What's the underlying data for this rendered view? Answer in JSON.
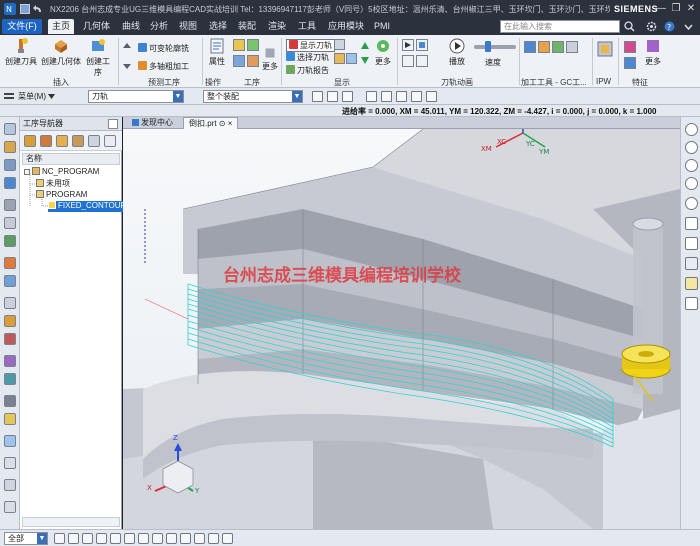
{
  "window": {
    "title": "NX2206 台州志成专业UG三维模具编程CAD实战培训  Tel：13396947117彭老师（V同号）5校区地址：温州乐清、台州椒江三甲、玉环坎门、玉环沙门、玉环坎门 - 加工",
    "brand": "SIEMENS",
    "minimize": "—",
    "restore": "❐",
    "close": "✕"
  },
  "menu": {
    "file": "文件(F)",
    "tabs": [
      "主页",
      "几何体",
      "曲线",
      "分析",
      "视图",
      "选择",
      "装配",
      "渲染",
      "工具",
      "应用模块",
      "PMI"
    ],
    "active_tab": "主页",
    "search_placeholder": "在此输入搜索"
  },
  "ribbon": {
    "create_tool": "创建刀具",
    "create_geometry": "创建几何体",
    "create_operation": "创建工序",
    "group_insert": "插入",
    "variable_contour": "可变轮廓铣",
    "multi_axis": "多轴粗加工",
    "group_preset": "预测工序",
    "properties": "属性",
    "group_operation": "操作",
    "more1": "更多",
    "group_process": "工序",
    "show_path": "显示刀轨",
    "select_path": "选择刀轨",
    "path_report": "刀轨报告",
    "more2": "更多",
    "group_display": "显示",
    "playback": "播放",
    "speed": "速度",
    "group_animation": "刀轨动画",
    "more3": "更多",
    "group_machining": "加工工具 - GC工...",
    "group_ipw": "IPW",
    "more4": "更多",
    "group_feature": "特征"
  },
  "selection_bar": {
    "menu_label": "菜单(M)",
    "filter_value": "刀轨",
    "scope_value": "整个装配"
  },
  "status": {
    "coords": "进给率 = 0.000, XM = 45.011, YM = 120.322, ZM = -4.427, i = 0.000, j = 0.000, k = 1.000"
  },
  "navigator": {
    "title": "工序导航器",
    "column_header": "名称",
    "tree": [
      {
        "label": "NC_PROGRAM",
        "depth": 0,
        "selected": false
      },
      {
        "label": "未用项",
        "depth": 1,
        "selected": false
      },
      {
        "label": "PROGRAM",
        "depth": 1,
        "selected": false
      },
      {
        "label": "FIXED_CONTOUR",
        "depth": 2,
        "selected": true
      }
    ]
  },
  "documents": {
    "tabs": [
      {
        "label": "发现中心",
        "active": false
      },
      {
        "label": "倒扣.prt ⊙ ×",
        "active": true
      }
    ]
  },
  "viewport": {
    "watermark": "台州志成三维模具编程培训学校",
    "axis_labels": {
      "xm": "XM",
      "xc": "XC",
      "yc": "YC",
      "ym": "YM",
      "z": "Z",
      "x": "X",
      "y": "Y"
    }
  },
  "bottom": {
    "filter_value": "全部"
  },
  "colors": {
    "accent": "#1e72d0",
    "toolpath": "#2dd3d6",
    "watermark": "#e0393f",
    "tool": "#f0d316"
  }
}
